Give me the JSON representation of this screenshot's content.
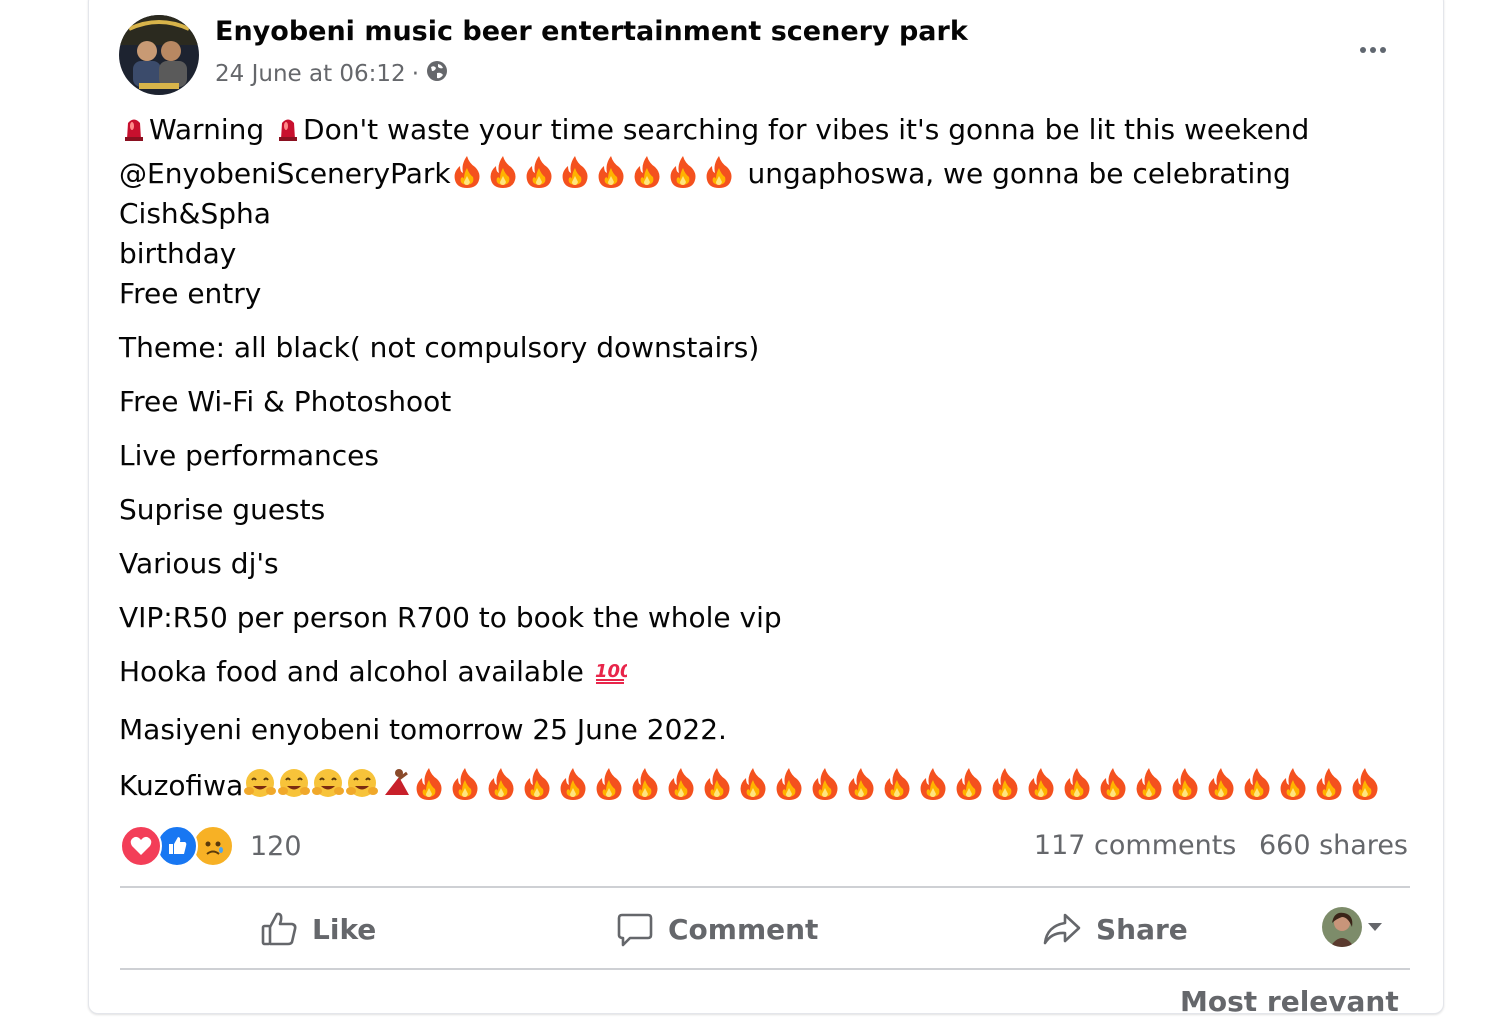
{
  "post": {
    "page_name": "Enyobeni music beer entertainment scenery park",
    "timestamp": "24 June at 06:12",
    "separator": "·",
    "privacy_icon": "globe-icon",
    "more_icon": "more-options-icon",
    "text": {
      "warning_word": "Warning",
      "warning_rest": "Don't waste your time searching for vibes it's gonna be lit this weekend",
      "mention": "@EnyobeniSceneryPark",
      "line2_rest": "ungaphoswa, we gonna be celebrating Cish&Spha",
      "line3": "birthday",
      "line4": "Free entry",
      "line5": "Theme: all black( not compulsory downstairs)",
      "line6": "Free Wi-Fi & Photoshoot",
      "line7": "Live performances",
      "line8": "Suprise guests",
      "line9": "Various dj's",
      "line10": "VIP:R50 per person R700 to book the whole vip",
      "line11": "Hooka food and alcohol available",
      "line12": "Masiyeni enyobeni tomorrow 25  June 2022.",
      "line13": "Kuzofiwa"
    }
  },
  "reactions": {
    "icons": [
      "love-reaction-icon",
      "like-reaction-icon",
      "sad-reaction-icon"
    ],
    "count": "120",
    "comments": "117 comments",
    "shares": "660 shares"
  },
  "actions": {
    "like": "Like",
    "comment": "Comment",
    "share": "Share"
  },
  "footer": {
    "partial_text": "Most relevant"
  },
  "colors": {
    "text_primary": "#050505",
    "text_secondary": "#65676b",
    "divider": "#ced0d4",
    "love": "#f33e58",
    "like": "#1877f2",
    "sad": "#f7b125"
  }
}
